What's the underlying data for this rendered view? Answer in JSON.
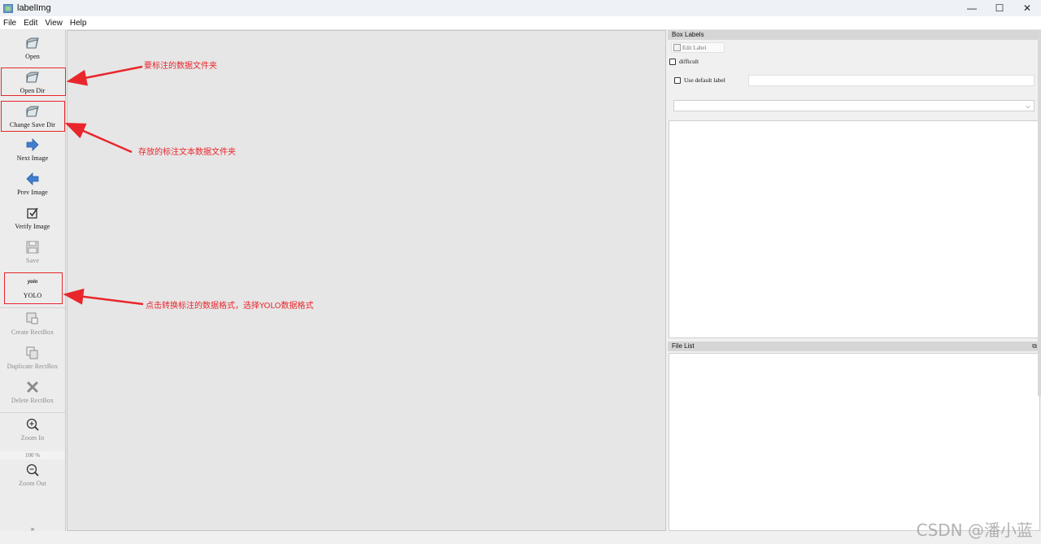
{
  "window": {
    "title": "labelImg",
    "controls": [
      "—",
      "☐",
      "✕"
    ]
  },
  "menu": [
    "File",
    "Edit",
    "View",
    "Help"
  ],
  "toolbar": {
    "open": "Open",
    "open_dir": "Open Dir",
    "change_save_dir": "Change Save Dir",
    "next_image": "Next Image",
    "prev_image": "Prev Image",
    "verify_image": "Verify Image",
    "save": "Save",
    "format_icon_text": "yolo",
    "format": "YOLO",
    "create_rectbox": "Create RectBox",
    "duplicate_rectbox": "Duplicate RectBox",
    "delete_rectbox": "Delete RectBox",
    "zoom_in": "Zoom In",
    "zoom_value": "100 %",
    "zoom_out": "Zoom Out",
    "more": "»"
  },
  "box_labels": {
    "title": "Box Labels",
    "edit_label": "Edit Label",
    "difficult": "difficult",
    "use_default_label": "Use default label",
    "default_label_value": ""
  },
  "file_list": {
    "title": "File List",
    "float_icon": "⧉"
  },
  "annotations": {
    "open_dir_note": "要标注的数据文件夹",
    "save_dir_note": "存放的标注文本数据文件夹",
    "format_note": "点击转换标注的数据格式，选择YOLO数据格式",
    "color": "#e8262b"
  },
  "watermark": "CSDN @潘小蓝"
}
